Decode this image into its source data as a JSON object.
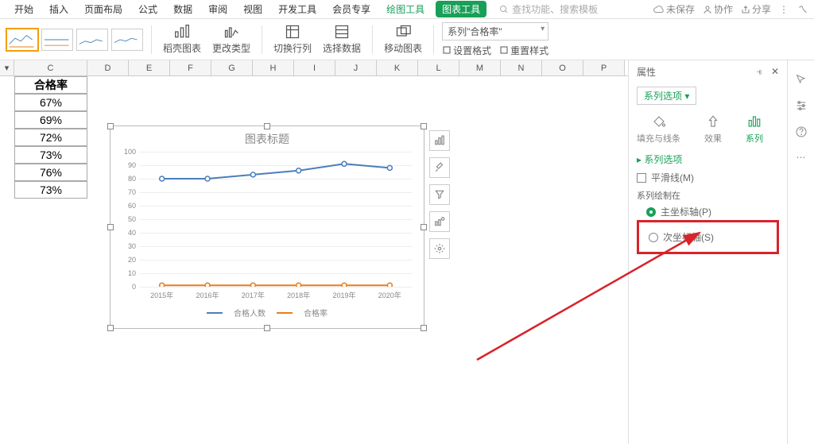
{
  "menu": {
    "tabs": [
      "开始",
      "插入",
      "页面布局",
      "公式",
      "数据",
      "审阅",
      "视图",
      "开发工具",
      "会员专享"
    ],
    "green_tab": "绘图工具",
    "chip": "图表工具",
    "search_placeholder": "查找功能、搜索模板",
    "unsaved": "未保存",
    "collab": "协作",
    "share": "分享"
  },
  "ribbon": {
    "buttons": [
      "稻壳图表",
      "更改类型",
      "切换行列",
      "选择数据",
      "移动图表"
    ],
    "combo_value": "系列\"合格率\"",
    "set_format": "设置格式",
    "reset_style": "重置样式"
  },
  "sheet": {
    "cols": [
      "C",
      "D",
      "E",
      "F",
      "G",
      "H",
      "I",
      "J",
      "K",
      "L",
      "M",
      "N",
      "O",
      "P"
    ],
    "data_header": "合格率",
    "data_values": [
      "67%",
      "69%",
      "72%",
      "73%",
      "76%",
      "73%"
    ]
  },
  "chart_data": {
    "type": "line",
    "title": "图表标题",
    "categories": [
      "2015年",
      "2016年",
      "2017年",
      "2018年",
      "2019年",
      "2020年"
    ],
    "yticks": [
      0,
      10,
      20,
      30,
      40,
      50,
      60,
      70,
      80,
      90,
      100
    ],
    "ylim": [
      0,
      100
    ],
    "series": [
      {
        "name": "合格人数",
        "values": [
          80,
          80,
          83,
          86,
          91,
          88
        ],
        "color": "#4a7ebb"
      },
      {
        "name": "合格率",
        "values": [
          1,
          1,
          1,
          1,
          1,
          1
        ],
        "color": "#e67e22"
      }
    ]
  },
  "props": {
    "title": "属性",
    "tab": "系列选项",
    "icon_tabs": [
      "填充与线条",
      "效果",
      "系列"
    ],
    "section": "系列选项",
    "smooth": "平滑线(M)",
    "draw_on": "系列绘制在",
    "primary": "主坐标轴(P)",
    "secondary": "次坐标轴(S)"
  }
}
